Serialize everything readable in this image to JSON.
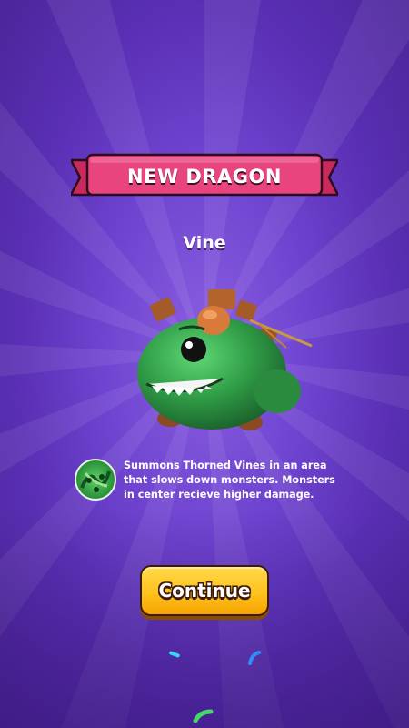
{
  "banner": {
    "title": "NEW DRAGON"
  },
  "dragon": {
    "name": "Vine",
    "color": "#2e9a45"
  },
  "ability": {
    "icon": "thorned-vines-icon",
    "description": "Summons Thorned Vines in an area that slows down monsters. Monsters in center recieve higher damage."
  },
  "continue_button": {
    "label": "Continue"
  },
  "colors": {
    "background": "#6f44d0",
    "banner": "#e03d77",
    "button": "#ffc21e"
  }
}
